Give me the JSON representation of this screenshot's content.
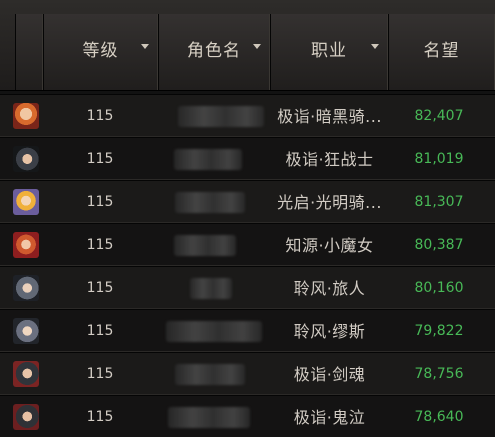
{
  "columns": {
    "level": "等级",
    "name": "角色名",
    "job": "职业",
    "fame": "名望"
  },
  "rows": [
    {
      "level": "115",
      "job": "极诣·暗黑骑...",
      "fame": "82,407",
      "avatar_icon": "female-orange-hair-avatar-icon"
    },
    {
      "level": "115",
      "job": "极诣·狂战士",
      "fame": "81,019",
      "avatar_icon": "male-dark-hair-avatar-icon"
    },
    {
      "level": "115",
      "job": "光启·光明骑...",
      "fame": "81,307",
      "avatar_icon": "female-blonde-knight-avatar-icon"
    },
    {
      "level": "115",
      "job": "知源·小魔女",
      "fame": "80,387",
      "avatar_icon": "female-witch-avatar-icon"
    },
    {
      "level": "115",
      "job": "聆风·旅人",
      "fame": "80,160",
      "avatar_icon": "male-traveler-avatar-icon"
    },
    {
      "level": "115",
      "job": "聆风·缪斯",
      "fame": "79,822",
      "avatar_icon": "female-muse-avatar-icon"
    },
    {
      "level": "115",
      "job": "极诣·剑魂",
      "fame": "78,756",
      "avatar_icon": "male-swordsman-avatar-icon"
    },
    {
      "level": "115",
      "job": "极诣·鬼泣",
      "fame": "78,640",
      "avatar_icon": "male-ghost-avatar-icon"
    }
  ],
  "colors": {
    "fame": "#48b957",
    "header_text": "#d7d0c4",
    "body_text": "#d2ccc4"
  }
}
